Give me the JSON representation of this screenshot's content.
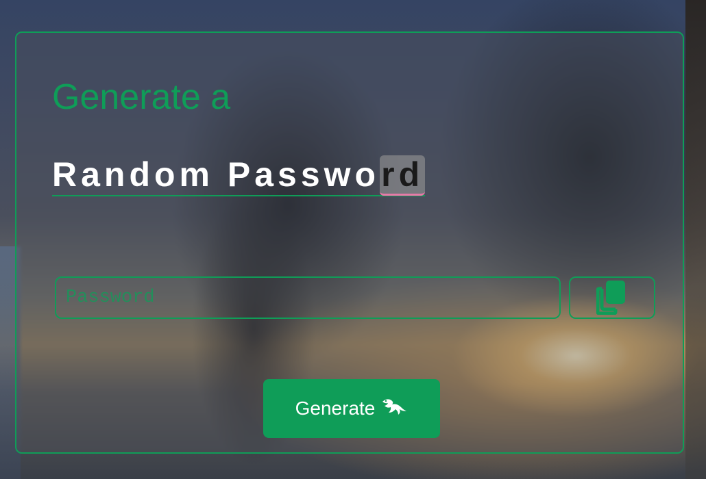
{
  "heading": {
    "subtitle": "Generate a",
    "title_typed": "Random Passwo",
    "title_highlight": "rd"
  },
  "password_field": {
    "value": "",
    "placeholder": "Password"
  },
  "copy_button": {
    "icon": "copy-icon"
  },
  "generate_button": {
    "label": "Generate",
    "icon": "dragon-icon"
  },
  "colors": {
    "accent": "#0f9d58",
    "cursor_highlight": "#e77aa8",
    "title_text": "#ffffff"
  }
}
